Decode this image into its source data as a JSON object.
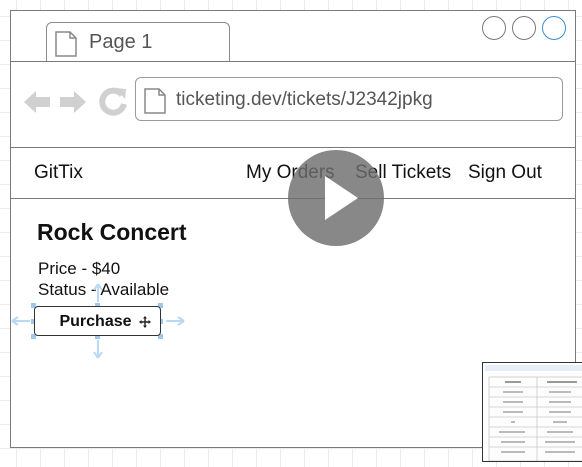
{
  "browser": {
    "tab_label": "Page 1",
    "url": "ticketing.dev/tickets/J2342jpkg"
  },
  "navbar": {
    "brand": "GitTix",
    "links": [
      "My Orders",
      "Sell Tickets",
      "Sign Out"
    ]
  },
  "ticket": {
    "title": "Rock Concert",
    "price_line": "Price - $40",
    "status_line": "Status - Available",
    "purchase_label": "Purchase"
  },
  "colors": {
    "frame": "#7a7a7a",
    "accent_circle": "#3b8ed6",
    "selection": "#9ec8ee",
    "play_overlay": "#6e6e6e"
  },
  "icons": [
    "page-icon",
    "back-arrow-icon",
    "forward-arrow-icon",
    "reload-icon",
    "play-icon",
    "move-cursor-icon"
  ]
}
